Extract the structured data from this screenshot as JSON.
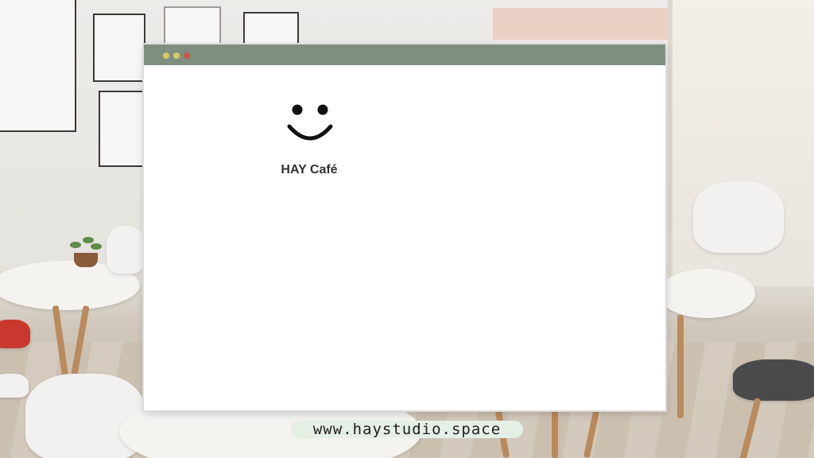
{
  "window": {
    "title": "HAY Café",
    "traffic_lights": [
      {
        "name": "minimize",
        "color": "#d9c96a"
      },
      {
        "name": "zoom",
        "color": "#d9c96a"
      },
      {
        "name": "close",
        "color": "#c4564a"
      }
    ],
    "titlebar_color": "#7f8f7f"
  },
  "app": {
    "icon": "smiley-face-icon",
    "name": "HAY Café"
  },
  "footer": {
    "url": "www.haystudio.space"
  },
  "colors": {
    "accent_pill": "#e4efe6",
    "text": "#333333"
  }
}
